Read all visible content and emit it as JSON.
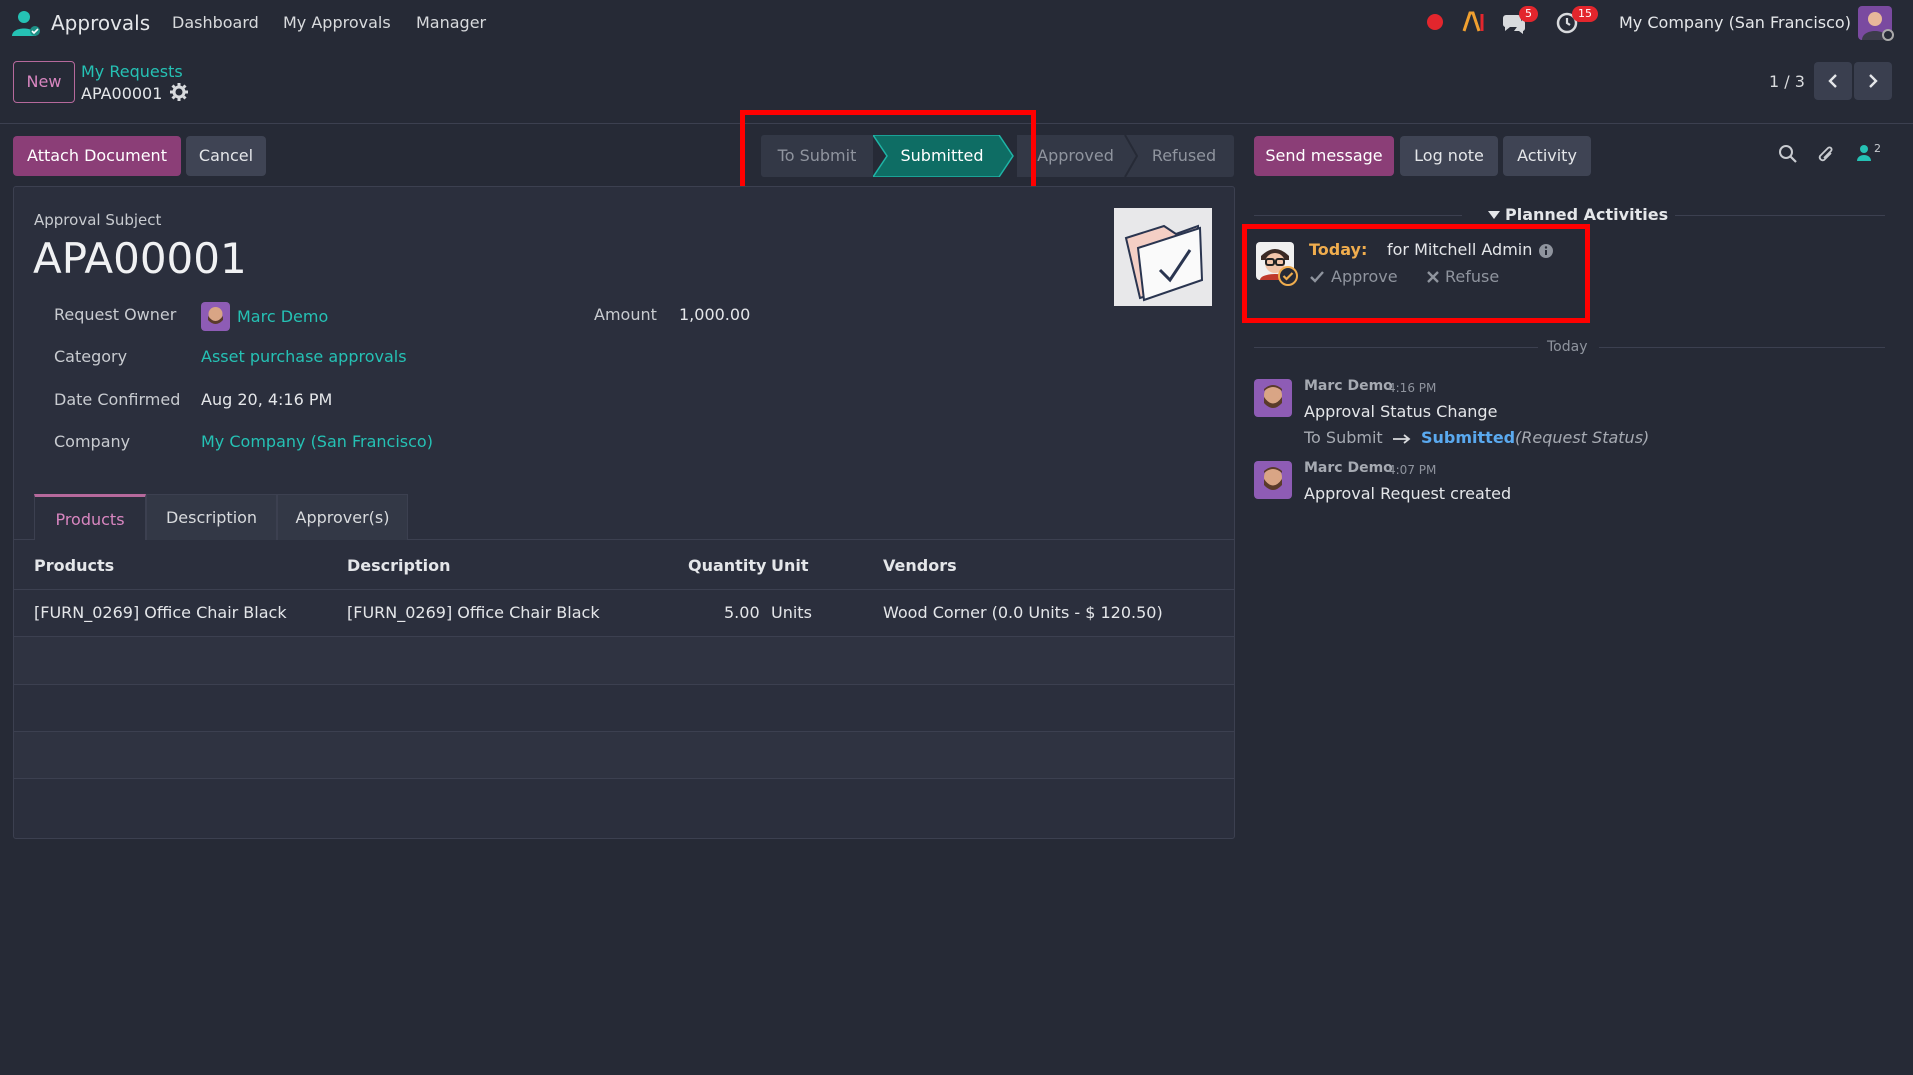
{
  "navbar": {
    "app_name": "Approvals",
    "menu": [
      "Dashboard",
      "My Approvals",
      "Manager"
    ],
    "messages_badge": "5",
    "activities_badge": "15",
    "company": "My Company (San Francisco)"
  },
  "control": {
    "new_label": "New",
    "breadcrumb_parent": "My Requests",
    "breadcrumb_current": "APA00001",
    "pager": "1 / 3"
  },
  "buttons": {
    "attach": "Attach Document",
    "cancel": "Cancel"
  },
  "status": {
    "steps": [
      "To Submit",
      "Submitted",
      "Approved",
      "Refused"
    ],
    "active": "Submitted"
  },
  "form": {
    "subject_label": "Approval Subject",
    "subject": "APA00001",
    "owner_label": "Request Owner",
    "owner": "Marc Demo",
    "amount_label": "Amount",
    "amount": "1,000.00",
    "category_label": "Category",
    "category": "Asset purchase approvals",
    "date_label": "Date Confirmed",
    "date": "Aug 20, 4:16 PM",
    "company_label": "Company",
    "company": "My Company (San Francisco)"
  },
  "tabs": [
    "Products",
    "Description",
    "Approver(s)"
  ],
  "table": {
    "headers": [
      "Products",
      "Description",
      "Quantity",
      "Unit",
      "Vendors"
    ],
    "rows": [
      [
        "[FURN_0269] Office Chair Black",
        "[FURN_0269] Office Chair Black",
        "5.00",
        "Units",
        "Wood Corner (0.0 Units - $ 120.50)"
      ]
    ]
  },
  "chatter": {
    "send_message": "Send message",
    "log_note": "Log note",
    "activity": "Activity",
    "followers_count": "2",
    "planned_title": "Planned Activities",
    "activity_when": "Today:",
    "activity_for": "for Mitchell Admin",
    "approve": "Approve",
    "refuse": "Refuse",
    "date_sep": "Today",
    "messages": [
      {
        "author": "Marc Demo",
        "time": "4:16 PM",
        "body": "Approval Status Change",
        "from": "To Submit",
        "to": "Submitted",
        "field": "(Request Status)"
      },
      {
        "author": "Marc Demo",
        "time": "4:07 PM",
        "body": "Approval Request created"
      }
    ]
  },
  "colors": {
    "accent": "#8b3e77",
    "link": "#25c1b4",
    "status_active": "#0e6d64",
    "highlight": "#ff0000",
    "warning": "#f0ad4e"
  }
}
